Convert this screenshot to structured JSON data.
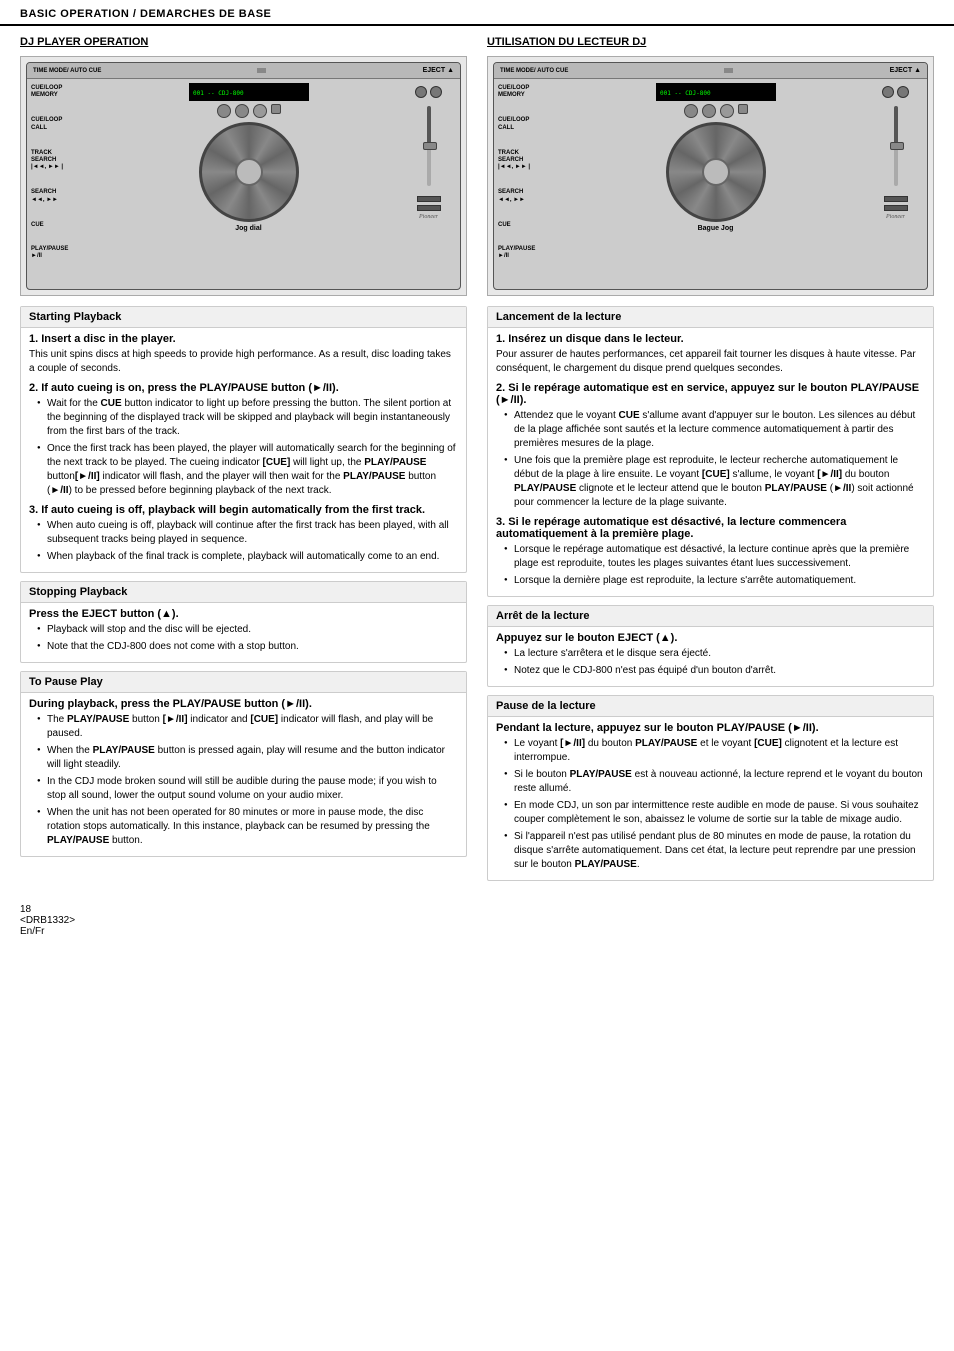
{
  "header": {
    "title": "BASIC OPERATION / DEMARCHES DE BASE"
  },
  "left": {
    "section_header": "DJ PLAYER OPERATION",
    "player_labels": {
      "time_mode": "TIME MODE/ AUTO CUE",
      "eject": "EJECT ▲",
      "cue_loop_memory": "CUE/LOOP\nMEMORY",
      "cue_loop_call": "CUE/LOOP\nCALL",
      "track_search": "TRACK\nSEARCH\n|◄◄, ►► |",
      "search": "SEARCH\n◄◄, ►►",
      "cue": "CUE",
      "play_pause": "PLAY/PAUSE\n►/II",
      "jog_label": "Jog dial"
    },
    "starting_playback": {
      "box_title": "Starting Playback",
      "steps": [
        {
          "num": "1.",
          "title": "Insert a disc in the player.",
          "body": "This unit spins discs at high speeds to provide high performance. As a result, disc loading takes a couple of seconds."
        },
        {
          "num": "2.",
          "title": "If auto cueing is on, press the PLAY/PAUSE button (►/II).",
          "bullets": [
            "Wait for the CUE button indicator to light up before pressing the button. The silent portion at the beginning of the displayed track will be skipped and playback will begin instantaneously from the first bars of the track.",
            "Once the first track has been played, the player will automatically search for the beginning of the next track to be played. The cueing indicator [CUE] will light up, the PLAY/PAUSE button [►/II] indicator will flash, and the player will then wait for the PLAY/PAUSE button (►/II) to be pressed before beginning playback of the next track."
          ]
        },
        {
          "num": "3.",
          "title": "If auto cueing is off, playback will begin automatically from the first track.",
          "bullets": [
            "When auto cueing is off, playback will continue after the first track has been played, with all subsequent tracks being played in sequence.",
            "When playback of the final track is complete, playback will automatically come to an end."
          ]
        }
      ]
    },
    "stopping_playback": {
      "box_title": "Stopping Playback",
      "press_label": "Press the EJECT button (▲).",
      "bullets": [
        "Playback will stop and the disc will be ejected.",
        "Note that the CDJ-800 does not come with a stop button."
      ]
    },
    "to_pause_play": {
      "box_title": "To Pause Play",
      "during_label": "During playback, press the PLAY/PAUSE button (►/II).",
      "bullets": [
        "The PLAY/PAUSE button [►/II] indicator and [CUE] indicator will flash, and play will be paused.",
        "When the PLAY/PAUSE button is pressed again, play will resume and the button indicator will light steadily.",
        "In the CDJ mode broken sound will still be audible during the pause mode; if you wish to stop all sound, lower the output sound volume on your audio mixer.",
        "When the unit has not been operated for 80 minutes or more in pause mode, the disc rotation stops automatically. In this instance, playback can be resumed by pressing the PLAY/PAUSE button."
      ]
    }
  },
  "right": {
    "section_header": "UTILISATION DU LECTEUR DJ",
    "player_labels": {
      "time_mode": "TIME MODE/ AUTO CUE",
      "eject": "EJECT ▲",
      "cue_loop_memory": "CUE/LOOP\nMEMORY",
      "cue_loop_call": "CUE/LOOP\nCALL",
      "track_search": "TRACK\nSEARCH\n|◄◄, ►► |",
      "search": "SEARCH\n◄◄, ►►",
      "cue": "CUE",
      "play_pause": "PLAY/PAUSE\n►/II",
      "jog_label": "Bague Jog"
    },
    "lancement": {
      "box_title": "Lancement de la lecture",
      "steps": [
        {
          "num": "1.",
          "title": "Insérez un disque dans le lecteur.",
          "body": "Pour assurer de hautes performances, cet appareil fait tourner les  disques à haute vitesse. Par conséquent, le chargement du disque prend quelques secondes."
        },
        {
          "num": "2.",
          "title": "Si le repérage automatique est en service, appuyez sur le bouton PLAY/PAUSE (►/II).",
          "bullets": [
            "Attendez que le voyant CUE s'allume avant d'appuyer sur le bouton. Les silences au début de la plage affichée sont sautés et la lecture commence automatiquement à partir des premières mesures de la plage.",
            "Une fois que la première plage est reproduite, le lecteur recherche automatiquement le début de la plage à lire ensuite. Le voyant [CUE] s'allume, le voyant [►/II] du bouton PLAY/PAUSE clignote et le lecteur attend que le bouton PLAY/PAUSE (►/II) soit actionné pour commencer la lecture de la plage suivante."
          ]
        },
        {
          "num": "3.",
          "title": "Si le repérage automatique est désactivé, la lecture commencera automatiquement à la première plage.",
          "bullets": [
            "Lorsque le repérage automatique est désactivé, la lecture continue après que la première plage est reproduite, toutes les plages suivantes étant lues successivement.",
            "Lorsque la dernière plage est reproduite, la lecture s'arrête automatiquement."
          ]
        }
      ]
    },
    "arret": {
      "box_title": "Arrêt de la lecture",
      "press_label": "Appuyez sur le bouton EJECT (▲).",
      "bullets": [
        "La lecture s'arrêtera et le disque sera éjecté.",
        "Notez que le CDJ-800 n'est pas équipé d'un bouton d'arrêt."
      ]
    },
    "pause": {
      "box_title": "Pause de la lecture",
      "during_label": "Pendant la lecture, appuyez sur le bouton PLAY/PAUSE (►/II).",
      "bullets": [
        "Le voyant [►/II] du bouton PLAY/PAUSE et le voyant [CUE] clignotent et la lecture est interrompue.",
        "Si le bouton PLAY/PAUSE est à nouveau actionné, la lecture reprend et le voyant du bouton reste allumé.",
        "En mode CDJ, un son par intermittence reste audible en mode de pause. Si vous souhaitez couper complètement le son, abaissez le volume de sortie sur la table de mixage audio.",
        "Si l'appareil n'est pas utilisé pendant plus de 80 minutes en mode de pause, la rotation du disque s'arrête automatiquement. Dans cet état, la lecture peut reprendre par une pression sur le bouton PLAY/PAUSE."
      ]
    }
  },
  "footer": {
    "page_num": "18",
    "model": "<DRB1332>",
    "lang": "En/Fr"
  }
}
